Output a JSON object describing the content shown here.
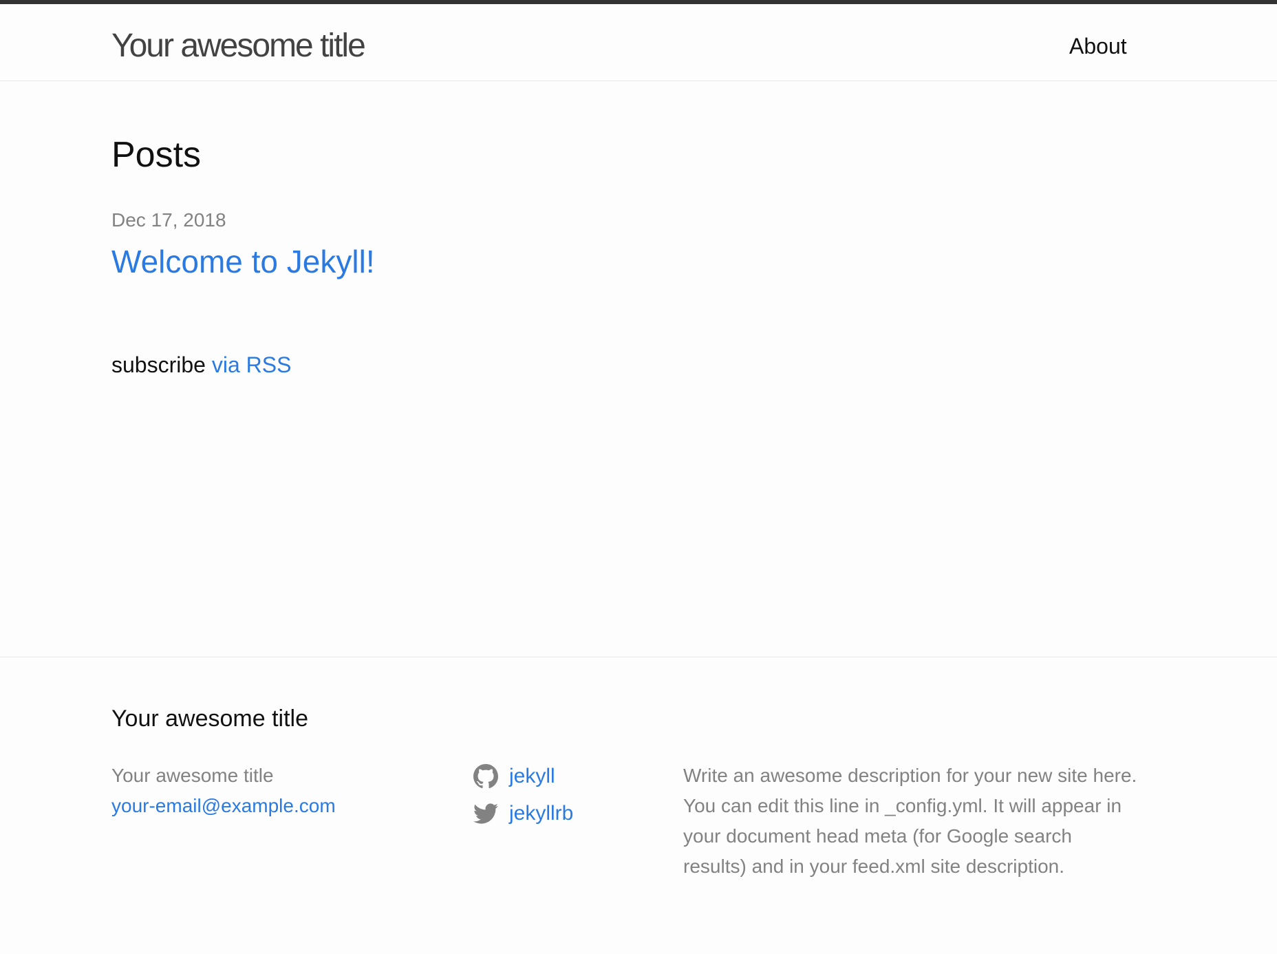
{
  "header": {
    "site_title": "Your awesome title",
    "nav_about": "About"
  },
  "main": {
    "posts_heading": "Posts",
    "post": {
      "date": "Dec 17, 2018",
      "title": "Welcome to Jekyll!"
    },
    "subscribe_prefix": "subscribe",
    "subscribe_link": "via RSS"
  },
  "footer": {
    "heading": "Your awesome title",
    "contact_name": "Your awesome title",
    "contact_email": "your-email@example.com",
    "social": [
      {
        "icon": "github-icon",
        "label": "jekyll"
      },
      {
        "icon": "twitter-icon",
        "label": "jekyllrb"
      }
    ],
    "description": "Write an awesome description for your new site here. You can edit this line in _config.yml. It will appear in your document head meta (for Google search results) and in your feed.xml site description."
  },
  "colors": {
    "link": "#2a7ae2",
    "muted": "#828282",
    "top_bar": "#333333"
  }
}
